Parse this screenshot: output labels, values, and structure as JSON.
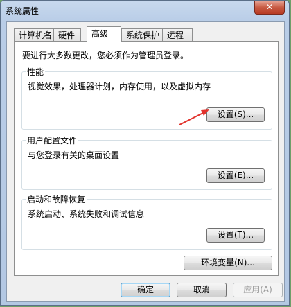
{
  "window": {
    "title": "系统属性",
    "close_label": "✕"
  },
  "tabs": [
    {
      "label": "计算机名"
    },
    {
      "label": "硬件"
    },
    {
      "label": "高级"
    },
    {
      "label": "系统保护"
    },
    {
      "label": "远程"
    }
  ],
  "advanced": {
    "notice": "要进行大多数更改，您必须作为管理员登录。",
    "performance": {
      "title": "性能",
      "description": "视觉效果，处理器计划，内存使用，以及虚拟内存",
      "button": "设置(S)..."
    },
    "user_profiles": {
      "title": "用户配置文件",
      "description": "与您登录有关的桌面设置",
      "button": "设置(E)..."
    },
    "startup_recovery": {
      "title": "启动和故障恢复",
      "description": "系统启动、系统失败和调试信息",
      "button": "设置(T)..."
    },
    "env_button": "环境变量(N)..."
  },
  "footer": {
    "ok": "确定",
    "cancel": "取消",
    "apply": "应用(A)"
  },
  "colors": {
    "annotation_arrow": "#e2312b",
    "titlebar": "#b9cde7",
    "close_button": "#c85b44"
  }
}
